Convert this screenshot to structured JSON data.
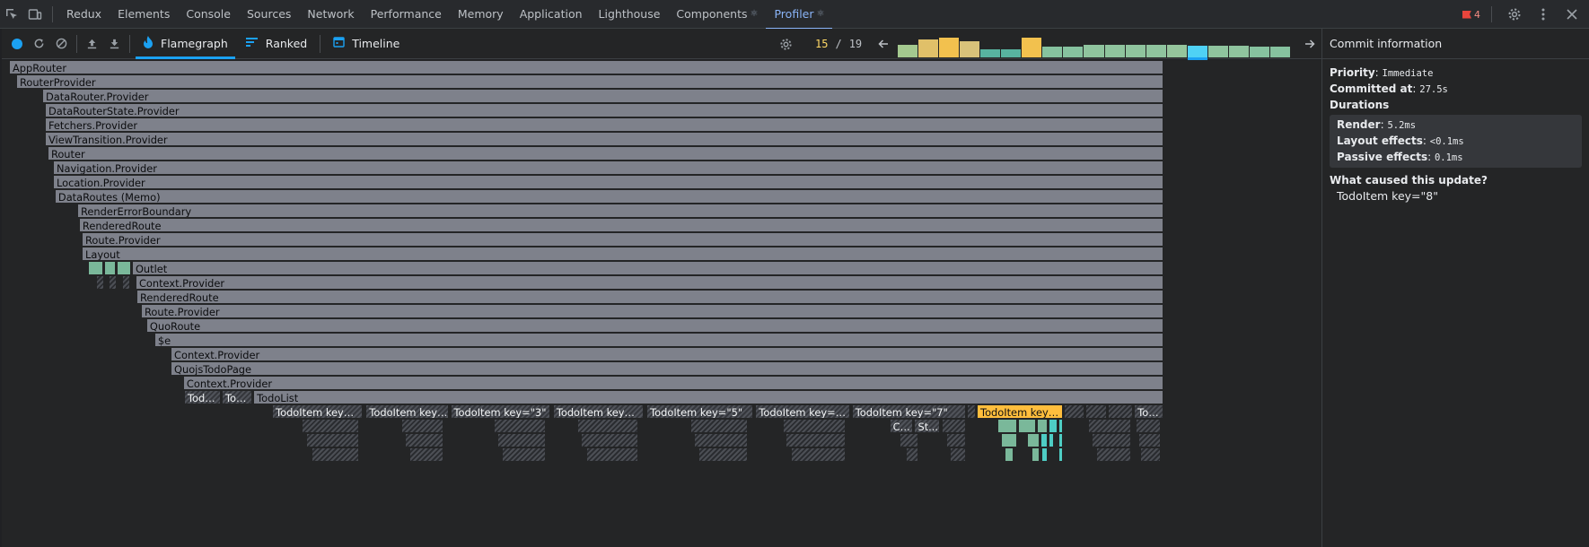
{
  "tabbar": {
    "tabs": [
      {
        "label": "Redux",
        "react": false,
        "active": false
      },
      {
        "label": "Elements",
        "react": false,
        "active": false
      },
      {
        "label": "Console",
        "react": false,
        "active": false
      },
      {
        "label": "Sources",
        "react": false,
        "active": false
      },
      {
        "label": "Network",
        "react": false,
        "active": false
      },
      {
        "label": "Performance",
        "react": false,
        "active": false
      },
      {
        "label": "Memory",
        "react": false,
        "active": false
      },
      {
        "label": "Application",
        "react": false,
        "active": false
      },
      {
        "label": "Lighthouse",
        "react": false,
        "active": false
      },
      {
        "label": "Components",
        "react": true,
        "active": false
      },
      {
        "label": "Profiler",
        "react": true,
        "active": true
      }
    ],
    "react_glyph": "⚛",
    "error_count": "4"
  },
  "toolbar": {
    "views": [
      {
        "label": "Flamegraph",
        "icon": "flame-icon",
        "active": true
      },
      {
        "label": "Ranked",
        "icon": "ranked-icon",
        "active": false
      },
      {
        "label": "Timeline",
        "icon": "timeline-icon",
        "active": false
      }
    ],
    "commit_current": "15",
    "commit_separator": "/",
    "commit_total": "19",
    "commit_bars": [
      {
        "height": 0.55,
        "color": "#a4c98f"
      },
      {
        "height": 0.75,
        "color": "#e0c069"
      },
      {
        "height": 0.85,
        "color": "#f2c14e"
      },
      {
        "height": 0.7,
        "color": "#d8c27a"
      },
      {
        "height": 0.36,
        "color": "#58b3a0"
      },
      {
        "height": 0.36,
        "color": "#58b3a0"
      },
      {
        "height": 0.85,
        "color": "#f2c14e"
      },
      {
        "height": 0.48,
        "color": "#86c29f"
      },
      {
        "height": 0.48,
        "color": "#86c29f"
      },
      {
        "height": 0.52,
        "color": "#8fc49e"
      },
      {
        "height": 0.52,
        "color": "#8fc49e"
      },
      {
        "height": 0.52,
        "color": "#8fc49e"
      },
      {
        "height": 0.52,
        "color": "#8fc49e"
      },
      {
        "height": 0.55,
        "color": "#95c59c"
      },
      {
        "height": 0.5,
        "color": "#4fd2f5",
        "selected": true
      },
      {
        "height": 0.5,
        "color": "#8fc49e"
      },
      {
        "height": 0.5,
        "color": "#8fc49e"
      },
      {
        "height": 0.48,
        "color": "#86c29f"
      },
      {
        "height": 0.48,
        "color": "#86c29f"
      }
    ]
  },
  "flamegraph": {
    "nodes": [
      {
        "label": "AppRouter",
        "depth": 0,
        "start": 0.0,
        "end": 1.0
      },
      {
        "label": "RouterProvider",
        "depth": 1,
        "start": 0.0062,
        "end": 1.0
      },
      {
        "label": "DataRouter.Provider",
        "depth": 2,
        "start": 0.0288,
        "end": 1.0
      },
      {
        "label": "DataRouterState.Provider",
        "depth": 3,
        "start": 0.0311,
        "end": 1.0
      },
      {
        "label": "Fetchers.Provider",
        "depth": 4,
        "start": 0.0311,
        "end": 1.0
      },
      {
        "label": "ViewTransition.Provider",
        "depth": 5,
        "start": 0.0311,
        "end": 1.0
      },
      {
        "label": "Router",
        "depth": 6,
        "start": 0.0334,
        "end": 1.0
      },
      {
        "label": "Navigation.Provider",
        "depth": 7,
        "start": 0.0381,
        "end": 1.0
      },
      {
        "label": "Location.Provider",
        "depth": 8,
        "start": 0.0381,
        "end": 1.0
      },
      {
        "label": "DataRoutes (Memo)",
        "depth": 9,
        "start": 0.0396,
        "end": 1.0
      },
      {
        "label": "RenderErrorBoundary",
        "depth": 10,
        "start": 0.0591,
        "end": 1.0
      },
      {
        "label": "RenderedRoute",
        "depth": 11,
        "start": 0.0606,
        "end": 1.0
      },
      {
        "label": "Route.Provider",
        "depth": 12,
        "start": 0.063,
        "end": 1.0
      },
      {
        "label": "Layout",
        "depth": 13,
        "start": 0.063,
        "end": 1.0
      },
      {
        "label": "",
        "depth": 14,
        "start": 0.0684,
        "end": 0.0816,
        "style": "green"
      },
      {
        "label": "",
        "depth": 14,
        "start": 0.0824,
        "end": 0.0925,
        "style": "green"
      },
      {
        "label": "",
        "depth": 14,
        "start": 0.0933,
        "end": 0.1057,
        "style": "green"
      },
      {
        "label": "Outlet",
        "depth": 14,
        "start": 0.1065,
        "end": 1.0
      },
      {
        "label": "",
        "depth": 15,
        "start": 0.0754,
        "end": 0.0824,
        "style": "hatch-dim"
      },
      {
        "label": "",
        "depth": 15,
        "start": 0.0863,
        "end": 0.0933,
        "style": "hatch-dim"
      },
      {
        "label": "",
        "depth": 15,
        "start": 0.0979,
        "end": 0.1049,
        "style": "hatch-dim"
      },
      {
        "label": "Context.Provider",
        "depth": 15,
        "start": 0.1096,
        "end": 1.0
      },
      {
        "label": "RenderedRoute",
        "depth": 16,
        "start": 0.1104,
        "end": 1.0
      },
      {
        "label": "Route.Provider",
        "depth": 17,
        "start": 0.1143,
        "end": 1.0
      },
      {
        "label": "QuoRoute",
        "depth": 18,
        "start": 0.1189,
        "end": 1.0
      },
      {
        "label": "$e",
        "depth": 19,
        "start": 0.1259,
        "end": 1.0
      },
      {
        "label": "Context.Provider",
        "depth": 20,
        "start": 0.14,
        "end": 1.0
      },
      {
        "label": "QuojsTodoPage",
        "depth": 21,
        "start": 0.14,
        "end": 1.0
      },
      {
        "label": "Context.Provider",
        "depth": 22,
        "start": 0.1508,
        "end": 1.0
      },
      {
        "label": "Todo...",
        "depth": 23,
        "start": 0.1516,
        "end": 0.1835,
        "style": "hatch"
      },
      {
        "label": "Tod...",
        "depth": 23,
        "start": 0.1843,
        "end": 0.2108,
        "style": "hatch"
      },
      {
        "label": "TodoList",
        "depth": 23,
        "start": 0.2116,
        "end": 1.0
      },
      {
        "label": "TodoItem key=\"1\"",
        "depth": 24,
        "start": 0.2279,
        "end": 0.3067,
        "style": "hatch"
      },
      {
        "label": "TodoItem key=\"2\"",
        "depth": 24,
        "start": 0.309,
        "end": 0.3807,
        "style": "hatch"
      },
      {
        "label": "TodoItem key=\"3\"",
        "depth": 24,
        "start": 0.3822,
        "end": 0.4688,
        "style": "hatch"
      },
      {
        "label": "TodoItem key=\"4\"",
        "depth": 24,
        "start": 0.4711,
        "end": 0.5499,
        "style": "hatch"
      },
      {
        "label": "TodoItem key=\"5\"",
        "depth": 24,
        "start": 0.5522,
        "end": 0.645,
        "style": "hatch"
      },
      {
        "label": "TodoItem key=\"6\"",
        "depth": 24,
        "start": 0.6465,
        "end": 0.7284,
        "style": "hatch"
      },
      {
        "label": "TodoItem key=\"7\"",
        "depth": 24,
        "start": 0.73,
        "end": 0.829,
        "style": "hatch"
      },
      {
        "label": "",
        "depth": 24,
        "start": 0.8298,
        "end": 0.8375,
        "style": "hatch-dim"
      },
      {
        "label": "TodoItem key=\"...",
        "depth": 24,
        "start": 0.8383,
        "end": 0.9126,
        "style": "selected"
      },
      {
        "label": "",
        "depth": 24,
        "start": 0.9134,
        "end": 0.9319,
        "style": "hatch-dim"
      },
      {
        "label": "",
        "depth": 24,
        "start": 0.9327,
        "end": 0.9513,
        "style": "hatch-dim"
      },
      {
        "label": "",
        "depth": 24,
        "start": 0.9521,
        "end": 0.9737,
        "style": "hatch-dim"
      },
      {
        "label": "Tod...",
        "depth": 24,
        "start": 0.9745,
        "end": 1.0,
        "style": "hatch"
      },
      {
        "label": "",
        "depth": 25,
        "start": 0.2535,
        "end": 0.3036,
        "style": "hatch-dim"
      },
      {
        "label": "",
        "depth": 25,
        "start": 0.34,
        "end": 0.376,
        "style": "hatch-dim"
      },
      {
        "label": "",
        "depth": 25,
        "start": 0.42,
        "end": 0.465,
        "style": "hatch-dim"
      },
      {
        "label": "",
        "depth": 25,
        "start": 0.492,
        "end": 0.545,
        "style": "hatch-dim"
      },
      {
        "label": "",
        "depth": 25,
        "start": 0.59,
        "end": 0.64,
        "style": "hatch-dim"
      },
      {
        "label": "",
        "depth": 25,
        "start": 0.67,
        "end": 0.725,
        "style": "hatch-dim"
      },
      {
        "label": "Cl...",
        "depth": 25,
        "start": 0.7625,
        "end": 0.7834,
        "style": "hatch"
      },
      {
        "label": "St...",
        "depth": 25,
        "start": 0.7842,
        "end": 0.8066,
        "style": "hatch"
      },
      {
        "label": "",
        "depth": 25,
        "start": 0.808,
        "end": 0.829,
        "style": "hatch-dim"
      },
      {
        "label": "",
        "depth": 25,
        "start": 0.8561,
        "end": 0.8731,
        "style": "green"
      },
      {
        "label": "",
        "depth": 25,
        "start": 0.8739,
        "end": 0.8894,
        "style": "green"
      },
      {
        "label": "",
        "depth": 25,
        "start": 0.8902,
        "end": 0.8995,
        "style": "green"
      },
      {
        "label": "",
        "depth": 25,
        "start": 0.9003,
        "end": 0.908,
        "style": "teal"
      },
      {
        "label": "",
        "depth": 25,
        "start": 0.9088,
        "end": 0.9126,
        "style": "teal"
      },
      {
        "label": "",
        "depth": 25,
        "start": 0.935,
        "end": 0.972,
        "style": "hatch-dim"
      },
      {
        "label": "",
        "depth": 25,
        "start": 0.976,
        "end": 0.998,
        "style": "hatch-dim"
      },
      {
        "label": "",
        "depth": 26,
        "start": 0.257,
        "end": 0.3036,
        "style": "hatch-dim"
      },
      {
        "label": "",
        "depth": 26,
        "start": 0.343,
        "end": 0.376,
        "style": "hatch-dim"
      },
      {
        "label": "",
        "depth": 26,
        "start": 0.423,
        "end": 0.465,
        "style": "hatch-dim"
      },
      {
        "label": "",
        "depth": 26,
        "start": 0.495,
        "end": 0.545,
        "style": "hatch-dim"
      },
      {
        "label": "",
        "depth": 26,
        "start": 0.593,
        "end": 0.64,
        "style": "hatch-dim"
      },
      {
        "label": "",
        "depth": 26,
        "start": 0.673,
        "end": 0.725,
        "style": "hatch-dim"
      },
      {
        "label": "",
        "depth": 26,
        "start": 0.771,
        "end": 0.788,
        "style": "hatch-dim"
      },
      {
        "label": "",
        "depth": 26,
        "start": 0.812,
        "end": 0.829,
        "style": "hatch-dim"
      },
      {
        "label": "",
        "depth": 26,
        "start": 0.8592,
        "end": 0.8731,
        "style": "green"
      },
      {
        "label": "",
        "depth": 26,
        "start": 0.8816,
        "end": 0.8925,
        "style": "green"
      },
      {
        "label": "",
        "depth": 26,
        "start": 0.8933,
        "end": 0.8995,
        "style": "teal"
      },
      {
        "label": "",
        "depth": 26,
        "start": 0.9003,
        "end": 0.9049,
        "style": "teal"
      },
      {
        "label": "",
        "depth": 26,
        "start": 0.9088,
        "end": 0.9126,
        "style": "teal"
      },
      {
        "label": "",
        "depth": 26,
        "start": 0.938,
        "end": 0.972,
        "style": "hatch-dim"
      },
      {
        "label": "",
        "depth": 26,
        "start": 0.978,
        "end": 0.998,
        "style": "hatch-dim"
      },
      {
        "label": "",
        "depth": 27,
        "start": 0.262,
        "end": 0.3036,
        "style": "hatch-dim"
      },
      {
        "label": "",
        "depth": 27,
        "start": 0.347,
        "end": 0.376,
        "style": "hatch-dim"
      },
      {
        "label": "",
        "depth": 27,
        "start": 0.427,
        "end": 0.465,
        "style": "hatch-dim"
      },
      {
        "label": "",
        "depth": 27,
        "start": 0.5,
        "end": 0.545,
        "style": "hatch-dim"
      },
      {
        "label": "",
        "depth": 27,
        "start": 0.597,
        "end": 0.64,
        "style": "hatch-dim"
      },
      {
        "label": "",
        "depth": 27,
        "start": 0.677,
        "end": 0.725,
        "style": "hatch-dim"
      },
      {
        "label": "",
        "depth": 27,
        "start": 0.777,
        "end": 0.788,
        "style": "hatch-dim"
      },
      {
        "label": "",
        "depth": 27,
        "start": 0.815,
        "end": 0.829,
        "style": "hatch-dim"
      },
      {
        "label": "",
        "depth": 27,
        "start": 0.8623,
        "end": 0.87,
        "style": "green"
      },
      {
        "label": "",
        "depth": 27,
        "start": 0.8855,
        "end": 0.8925,
        "style": "green"
      },
      {
        "label": "",
        "depth": 27,
        "start": 0.894,
        "end": 0.8995,
        "style": "teal"
      },
      {
        "label": "",
        "depth": 27,
        "start": 0.9088,
        "end": 0.9126,
        "style": "teal"
      },
      {
        "label": "",
        "depth": 27,
        "start": 0.942,
        "end": 0.972,
        "style": "hatch-dim"
      },
      {
        "label": "",
        "depth": 27,
        "start": 0.98,
        "end": 0.998,
        "style": "hatch-dim"
      }
    ]
  },
  "sidebar": {
    "title": "Commit information",
    "priority_label": "Priority",
    "priority_value": "Immediate",
    "committed_label": "Committed at",
    "committed_value": "27.5s",
    "durations_label": "Durations",
    "render_label": "Render",
    "render_value": "5.2ms",
    "layout_label": "Layout effects",
    "layout_value": "<0.1ms",
    "passive_label": "Passive effects",
    "passive_value": "0.1ms",
    "cause_label": "What caused this update?",
    "cause_item": "TodoItem key=\"8\""
  }
}
